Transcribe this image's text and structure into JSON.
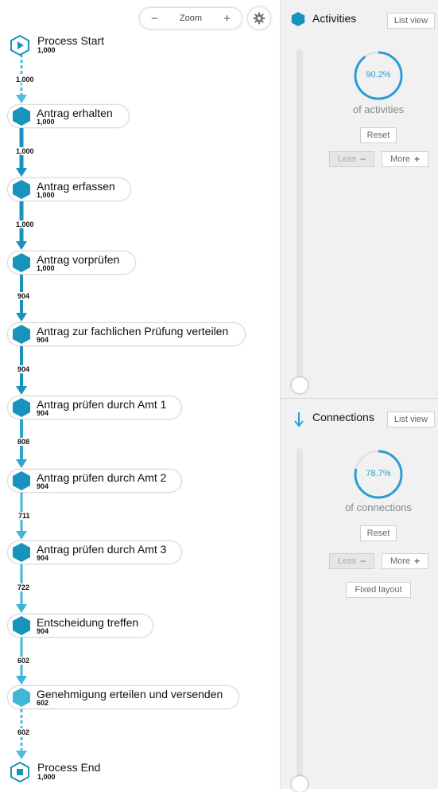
{
  "toolbar": {
    "zoom_label": "Zoom",
    "zoom_out_icon": "minus-icon",
    "zoom_in_icon": "plus-icon",
    "settings_icon": "gear-icon"
  },
  "process": {
    "start": {
      "label": "Process Start",
      "count": "1,000"
    },
    "end": {
      "label": "Process End",
      "count": "1,000"
    },
    "activities": [
      {
        "label": "Antrag erhalten",
        "count": "1,000"
      },
      {
        "label": "Antrag erfassen",
        "count": "1,000"
      },
      {
        "label": "Antrag vorprüfen",
        "count": "1,000"
      },
      {
        "label": "Antrag zur fachlichen Prüfung verteilen",
        "count": "904"
      },
      {
        "label": "Antrag prüfen durch Amt 1",
        "count": "904"
      },
      {
        "label": "Antrag prüfen durch Amt 2",
        "count": "904"
      },
      {
        "label": "Antrag prüfen durch Amt 3",
        "count": "904"
      },
      {
        "label": "Entscheidung treffen",
        "count": "904"
      },
      {
        "label": "Genehmigung erteilen und versenden",
        "count": "602"
      }
    ],
    "edges": [
      "1,000",
      "1,000",
      "1,000",
      "904",
      "904",
      "808",
      "711",
      "722",
      "602",
      "602"
    ]
  },
  "panel": {
    "activities": {
      "title": "Activities",
      "list_view": "List view",
      "percent": "90.2%",
      "percent_value": 0.902,
      "of_label": "of activities",
      "reset": "Reset",
      "less": "Less",
      "more": "More",
      "slider_value": 0.0
    },
    "connections": {
      "title": "Connections",
      "list_view": "List view",
      "percent": "78.7%",
      "percent_value": 0.787,
      "of_label": "of connections",
      "reset": "Reset",
      "less": "Less",
      "more": "More",
      "fixed_layout": "Fixed layout",
      "slider_value": 0.0
    }
  },
  "colors": {
    "accent": "#1893bd",
    "accent_light": "#3fb6d8",
    "ring": "#2a9dd6",
    "dashed": "#4fbde0"
  }
}
